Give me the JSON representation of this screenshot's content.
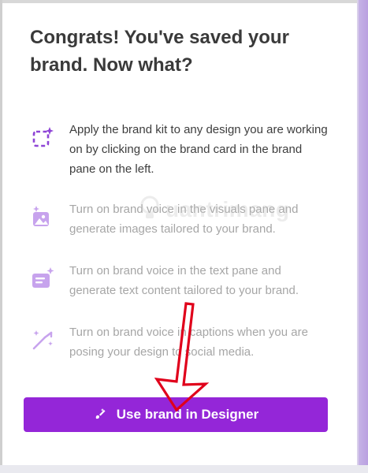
{
  "dialog": {
    "title": "Congrats! You've saved your brand. Now what?",
    "features": [
      {
        "icon": "brand-kit-select-icon",
        "text": "Apply the brand kit to any design you are working on by clicking on the brand card in the brand pane on the left.",
        "state": "active"
      },
      {
        "icon": "image-sparkle-icon",
        "text": "Turn on brand voice in the visuals pane and generate images tailored to your brand.",
        "state": "muted"
      },
      {
        "icon": "text-sparkle-icon",
        "text": "Turn on brand voice in the text pane and generate text content tailored to your brand.",
        "state": "muted"
      },
      {
        "icon": "magic-wand-icon",
        "text": "Turn on brand voice in captions when you are posing your design to social media.",
        "state": "muted"
      }
    ],
    "cta": {
      "label": "Use brand in Designer",
      "icon": "brush-icon"
    }
  },
  "watermark": {
    "text": "uantrimang"
  },
  "colors": {
    "accent": "#9426d8",
    "icon_purple": "#8e44d6",
    "title": "#3a3a3a",
    "body_text": "#3d3d3d",
    "muted_text": "#a6a6a6",
    "annotation_arrow": "#e0001b"
  }
}
